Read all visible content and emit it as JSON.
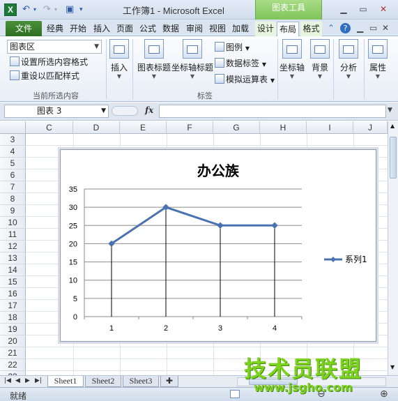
{
  "window": {
    "title": "工作簿1 - Microsoft Excel",
    "contextual_group": "图表工具"
  },
  "tabs": [
    "文件",
    "经典",
    "开始",
    "插入",
    "页面",
    "公式",
    "数据",
    "审阅",
    "视图",
    "加载",
    "设计",
    "布局",
    "格式"
  ],
  "active_tab": "布局",
  "ribbon": {
    "current_selection": {
      "dropdown_value": "图表区",
      "format_selection": "设置所选内容格式",
      "reset_style": "重设以匹配样式",
      "group_label": "当前所选内容"
    },
    "insert_label": "插入",
    "labels_group": {
      "chart_title": "图表标题",
      "axis_title": "坐标轴标题",
      "legend": "图例",
      "data_labels": "数据标签",
      "data_table": "模拟运算表",
      "group_label": "标签"
    },
    "axes": "坐标轴",
    "background": "背景",
    "analysis": "分析",
    "properties": "属性"
  },
  "formula_bar": {
    "name_box": "图表 3",
    "fx": "fx",
    "formula": ""
  },
  "columns": [
    "C",
    "D",
    "E",
    "F",
    "G",
    "H",
    "I",
    "J"
  ],
  "rows": [
    "3",
    "4",
    "5",
    "6",
    "7",
    "8",
    "9",
    "10",
    "11",
    "12",
    "13",
    "14",
    "15",
    "16",
    "17",
    "18",
    "19",
    "20",
    "21",
    "22",
    "23"
  ],
  "chart_data": {
    "type": "line",
    "title": "办公族",
    "categories": [
      "1",
      "2",
      "3",
      "4"
    ],
    "series": [
      {
        "name": "系列1",
        "values": [
          20,
          30,
          25,
          25
        ],
        "color": "#4a72b0"
      }
    ],
    "ylim": [
      0,
      35
    ],
    "yticks": [
      0,
      5,
      10,
      15,
      20,
      25,
      30,
      35
    ],
    "drop_lines": true,
    "grid": true,
    "legend_position": "right"
  },
  "sheets": [
    "Sheet1",
    "Sheet2",
    "Sheet3"
  ],
  "active_sheet": "Sheet1",
  "status": "就绪",
  "watermark": {
    "text": "技术员联盟",
    "url": "www.jsgho.com"
  }
}
